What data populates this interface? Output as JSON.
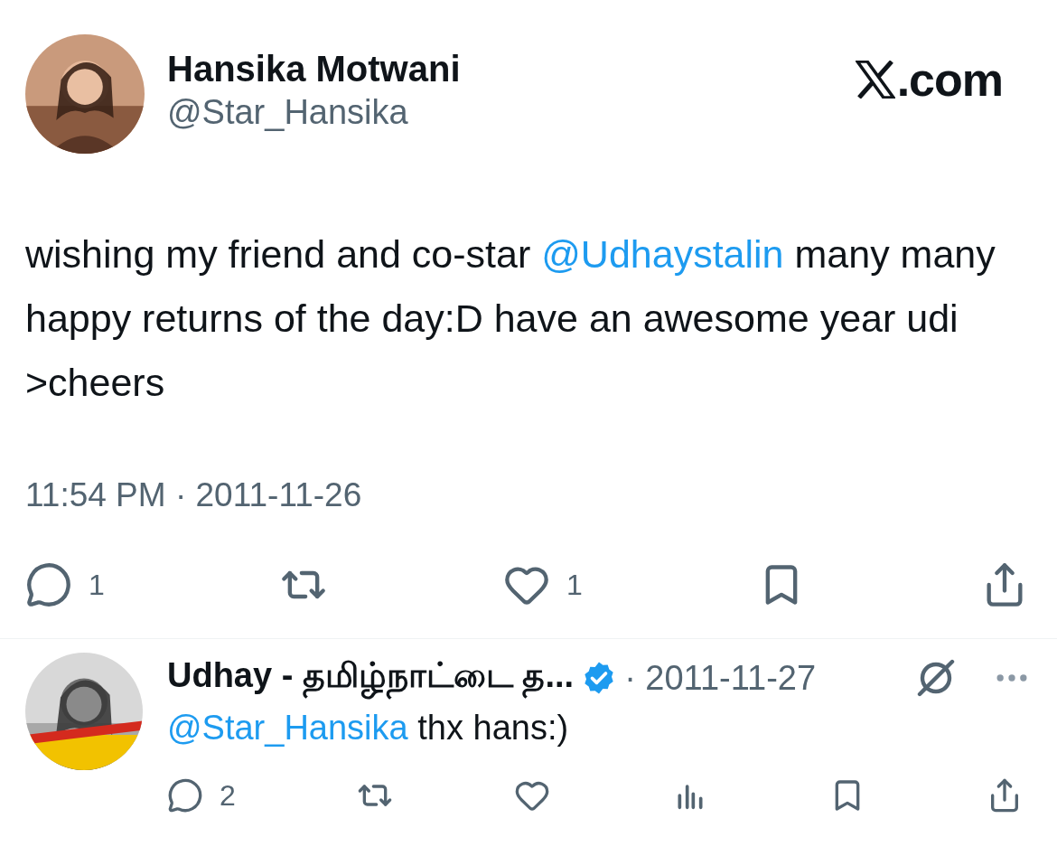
{
  "tweet": {
    "author": {
      "name": "Hansika Motwani",
      "handle": "@Star_Hansika"
    },
    "brand": ".com",
    "text": [
      {
        "kind": "text",
        "text": "wishing my friend and co-star "
      },
      {
        "kind": "mention",
        "text": "@Udhaystalin"
      },
      {
        "kind": "text",
        "text": " many many happy returns of the day:D have an awesome year udi >cheers"
      }
    ],
    "timestamp": "11:54 PM · 2011-11-26",
    "actions": [
      {
        "kind": "reply",
        "count": "1"
      },
      {
        "kind": "retweet"
      },
      {
        "kind": "like",
        "count": "1"
      },
      {
        "kind": "bookmark"
      },
      {
        "kind": "share"
      }
    ]
  },
  "reply": {
    "author": {
      "name": "Udhay - தமிழ்நாட்டை த...",
      "verified": true
    },
    "date": "· 2011-11-27",
    "text": [
      {
        "kind": "mention",
        "text": "@Star_Hansika"
      },
      {
        "kind": "text",
        "text": " thx hans:)"
      }
    ],
    "actions": [
      {
        "kind": "reply",
        "count": "2"
      },
      {
        "kind": "retweet"
      },
      {
        "kind": "like"
      },
      {
        "kind": "views"
      },
      {
        "kind": "bookmark"
      },
      {
        "kind": "share"
      }
    ]
  }
}
